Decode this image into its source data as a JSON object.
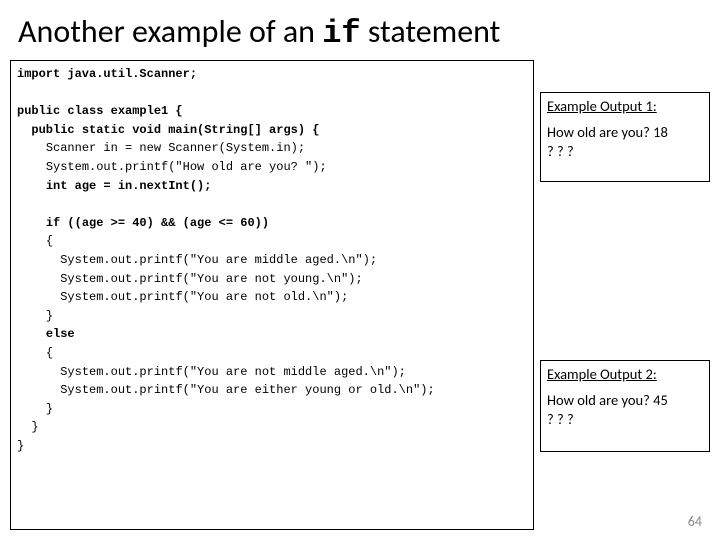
{
  "title_before": "Another example of an ",
  "title_code": "if",
  "title_after": " statement",
  "code": {
    "l01": "import java.util.Scanner;",
    "l02": "",
    "l03a": "public class example1 {",
    "l04a": "  public static void main(String[] args) {",
    "l05": "    Scanner in = new Scanner(System.in);",
    "l06": "    System.out.printf(\"How old are you? \");",
    "l07a": "    int age = in.nextInt();",
    "l08": "",
    "l09a": "    if ((age >= 40) && (age <= 60))",
    "l10": "    {",
    "l11": "      System.out.printf(\"You are middle aged.\\n\");",
    "l12": "      System.out.printf(\"You are not young.\\n\");",
    "l13": "      System.out.printf(\"You are not old.\\n\");",
    "l14": "    }",
    "l15a": "    else",
    "l16": "    {",
    "l17": "      System.out.printf(\"You are not middle aged.\\n\");",
    "l18": "      System.out.printf(\"You are either young or old.\\n\");",
    "l19": "    }",
    "l20": "  }",
    "l21": "}"
  },
  "out1": {
    "title": "Example Output 1:",
    "line1": "How old are you? 18",
    "line2": "? ? ?"
  },
  "out2": {
    "title": "Example Output 2:",
    "line1": "How old are you? 45",
    "line2": "? ? ?"
  },
  "page_num": "64"
}
